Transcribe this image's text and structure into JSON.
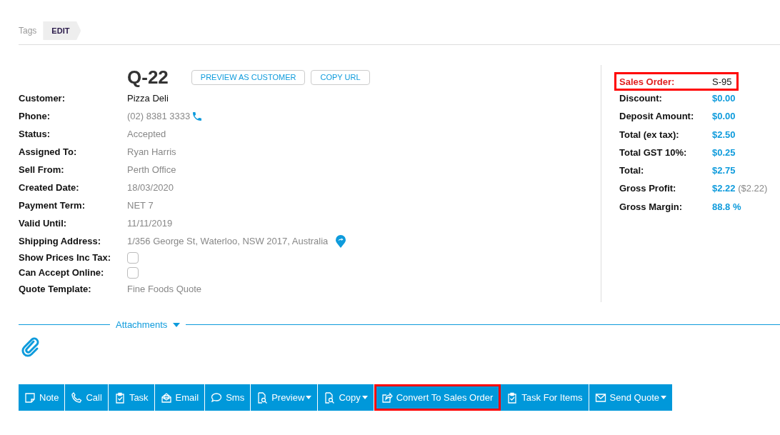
{
  "tags": {
    "label": "Tags",
    "edit": "EDIT"
  },
  "quote": {
    "number": "Q-22",
    "buttons": [
      "PREVIEW AS CUSTOMER",
      "COPY URL"
    ]
  },
  "fields": [
    {
      "label": "Customer:",
      "kind": "text",
      "value": "Pizza Deli",
      "emphasis": true
    },
    {
      "label": "Phone:",
      "kind": "phone",
      "value": "(02) 8381 3333",
      "emphasis": false
    },
    {
      "label": "Status:",
      "kind": "text",
      "value": "Accepted",
      "emphasis": false
    },
    {
      "label": "Assigned To:",
      "kind": "text",
      "value": "Ryan Harris",
      "emphasis": false
    },
    {
      "label": "Sell From:",
      "kind": "text",
      "value": "Perth Office",
      "emphasis": false
    },
    {
      "label": "Created Date:",
      "kind": "text",
      "value": "18/03/2020",
      "emphasis": false
    },
    {
      "label": "Payment Term:",
      "kind": "text",
      "value": "NET 7",
      "emphasis": false
    },
    {
      "label": "Valid Until:",
      "kind": "text",
      "value": "11/11/2019",
      "emphasis": false
    },
    {
      "label": "Shipping Address:",
      "kind": "address",
      "value": "1/356 George St, Waterloo, NSW 2017, Australia",
      "emphasis": false
    },
    {
      "label": "Show Prices Inc Tax:",
      "kind": "checkbox",
      "checked": false
    },
    {
      "label": "Can Accept Online:",
      "kind": "checkbox",
      "checked": false
    },
    {
      "label": "Quote Template:",
      "kind": "text",
      "value": "Fine Foods Quote",
      "emphasis": false
    }
  ],
  "summary": [
    {
      "label": "Sales Order:",
      "value": "S-95",
      "highlighted": true
    },
    {
      "label": "Discount:",
      "value": "$0.00",
      "highlighted": false
    },
    {
      "label": "Deposit Amount:",
      "value": "$0.00",
      "highlighted": false
    },
    {
      "label": "Total (ex tax):",
      "value": "$2.50",
      "highlighted": false
    },
    {
      "label": "Total GST 10%:",
      "value": "$0.25",
      "highlighted": false
    },
    {
      "label": "Total:",
      "value": "$2.75",
      "highlighted": false
    },
    {
      "label": "Gross Profit:",
      "value": "$2.22",
      "extra": "($2.22)",
      "highlighted": false
    },
    {
      "label": "Gross Margin:",
      "value": "88.8 %",
      "highlighted": false
    }
  ],
  "attachments": {
    "label": "Attachments"
  },
  "toolbar": [
    {
      "kind": "note",
      "label": "Note",
      "dropdown": false,
      "highlighted": false
    },
    {
      "kind": "call",
      "label": "Call",
      "dropdown": false,
      "highlighted": false
    },
    {
      "kind": "task",
      "label": "Task",
      "dropdown": false,
      "highlighted": false
    },
    {
      "kind": "email",
      "label": "Email",
      "dropdown": false,
      "highlighted": false
    },
    {
      "kind": "sms",
      "label": "Sms",
      "dropdown": false,
      "highlighted": false
    },
    {
      "kind": "preview",
      "label": "Preview",
      "dropdown": true,
      "highlighted": false
    },
    {
      "kind": "preview",
      "label": "Copy",
      "dropdown": true,
      "highlighted": false
    },
    {
      "kind": "convert",
      "label": "Convert To Sales Order",
      "dropdown": false,
      "highlighted": true
    },
    {
      "kind": "task",
      "label": "Task For Items",
      "dropdown": false,
      "highlighted": false
    },
    {
      "kind": "send",
      "label": "Send Quote",
      "dropdown": true,
      "highlighted": false
    }
  ]
}
